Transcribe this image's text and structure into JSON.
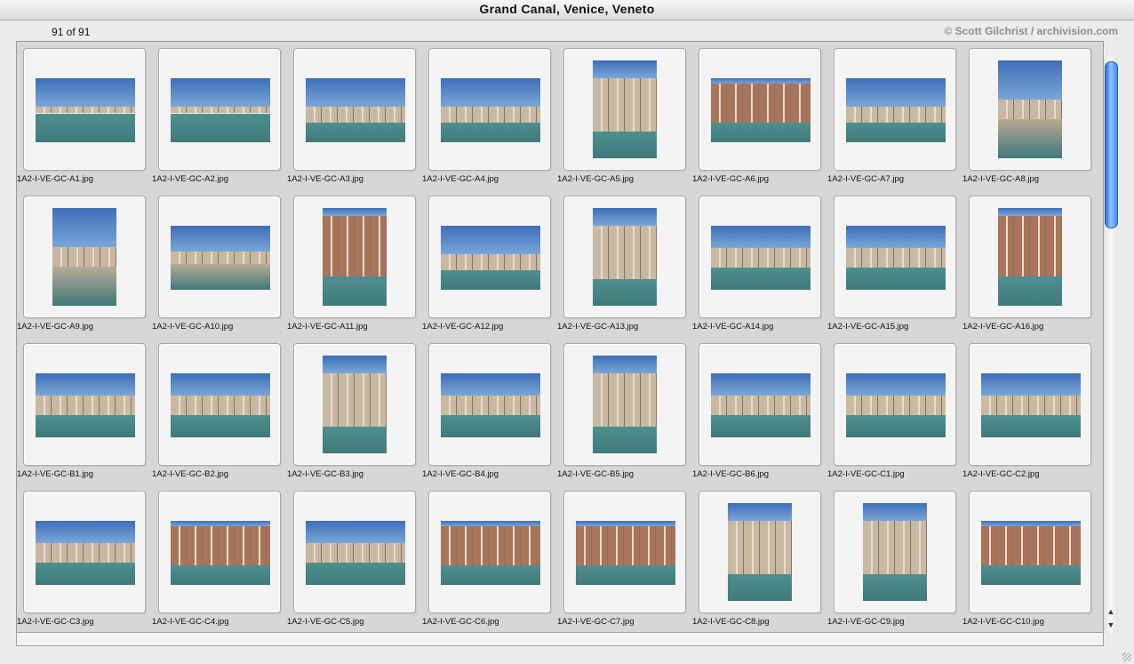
{
  "window": {
    "title": "Grand Canal, Venice, Veneto"
  },
  "header": {
    "count": "91 of 91",
    "copyright": "© Scott Gilchrist / archivision.com"
  },
  "colors": {
    "sky": "#3d6fb8",
    "water": "#4f8f8f",
    "stone": "#c9b9a2",
    "brick": "#a8745a"
  },
  "thumbnails": [
    {
      "name": "1A2-I-VE-GC-A1.jpg",
      "o": "l",
      "b": "far"
    },
    {
      "name": "1A2-I-VE-GC-A2.jpg",
      "o": "l",
      "b": "far"
    },
    {
      "name": "1A2-I-VE-GC-A3.jpg",
      "o": "l",
      "b": "low"
    },
    {
      "name": "1A2-I-VE-GC-A4.jpg",
      "o": "l",
      "b": "low"
    },
    {
      "name": "1A2-I-VE-GC-A5.jpg",
      "o": "p",
      "b": "tall"
    },
    {
      "name": "1A2-I-VE-GC-A6.jpg",
      "o": "l",
      "b": "full"
    },
    {
      "name": "1A2-I-VE-GC-A7.jpg",
      "o": "l",
      "b": "low"
    },
    {
      "name": "1A2-I-VE-GC-A8.jpg",
      "o": "p",
      "b": "plaza"
    },
    {
      "name": "1A2-I-VE-GC-A9.jpg",
      "o": "p",
      "b": "plaza"
    },
    {
      "name": "1A2-I-VE-GC-A10.jpg",
      "o": "l",
      "b": "plaza"
    },
    {
      "name": "1A2-I-VE-GC-A11.jpg",
      "o": "p",
      "b": "full"
    },
    {
      "name": "1A2-I-VE-GC-A12.jpg",
      "o": "l",
      "b": "low"
    },
    {
      "name": "1A2-I-VE-GC-A13.jpg",
      "o": "p",
      "b": "tall"
    },
    {
      "name": "1A2-I-VE-GC-A14.jpg",
      "o": "l",
      "b": "mid"
    },
    {
      "name": "1A2-I-VE-GC-A15.jpg",
      "o": "l",
      "b": "mid"
    },
    {
      "name": "1A2-I-VE-GC-A16.jpg",
      "o": "p",
      "b": "full"
    },
    {
      "name": "1A2-I-VE-GC-B1.jpg",
      "o": "l",
      "b": "mid"
    },
    {
      "name": "1A2-I-VE-GC-B2.jpg",
      "o": "l",
      "b": "mid"
    },
    {
      "name": "1A2-I-VE-GC-B3.jpg",
      "o": "p",
      "b": "tall"
    },
    {
      "name": "1A2-I-VE-GC-B4.jpg",
      "o": "l",
      "b": "mid"
    },
    {
      "name": "1A2-I-VE-GC-B5.jpg",
      "o": "p",
      "b": "tall"
    },
    {
      "name": "1A2-I-VE-GC-B6.jpg",
      "o": "l",
      "b": "mid"
    },
    {
      "name": "1A2-I-VE-GC-C1.jpg",
      "o": "l",
      "b": "mid"
    },
    {
      "name": "1A2-I-VE-GC-C2.jpg",
      "o": "l",
      "b": "mid"
    },
    {
      "name": "1A2-I-VE-GC-C3.jpg",
      "o": "l",
      "b": "mid"
    },
    {
      "name": "1A2-I-VE-GC-C4.jpg",
      "o": "l",
      "b": "full"
    },
    {
      "name": "1A2-I-VE-GC-C5.jpg",
      "o": "l",
      "b": "mid"
    },
    {
      "name": "1A2-I-VE-GC-C6.jpg",
      "o": "l",
      "b": "full"
    },
    {
      "name": "1A2-I-VE-GC-C7.jpg",
      "o": "l",
      "b": "full"
    },
    {
      "name": "1A2-I-VE-GC-C8.jpg",
      "o": "p",
      "b": "tall"
    },
    {
      "name": "1A2-I-VE-GC-C9.jpg",
      "o": "p",
      "b": "tall"
    },
    {
      "name": "1A2-I-VE-GC-C10.jpg",
      "o": "l",
      "b": "full"
    }
  ]
}
